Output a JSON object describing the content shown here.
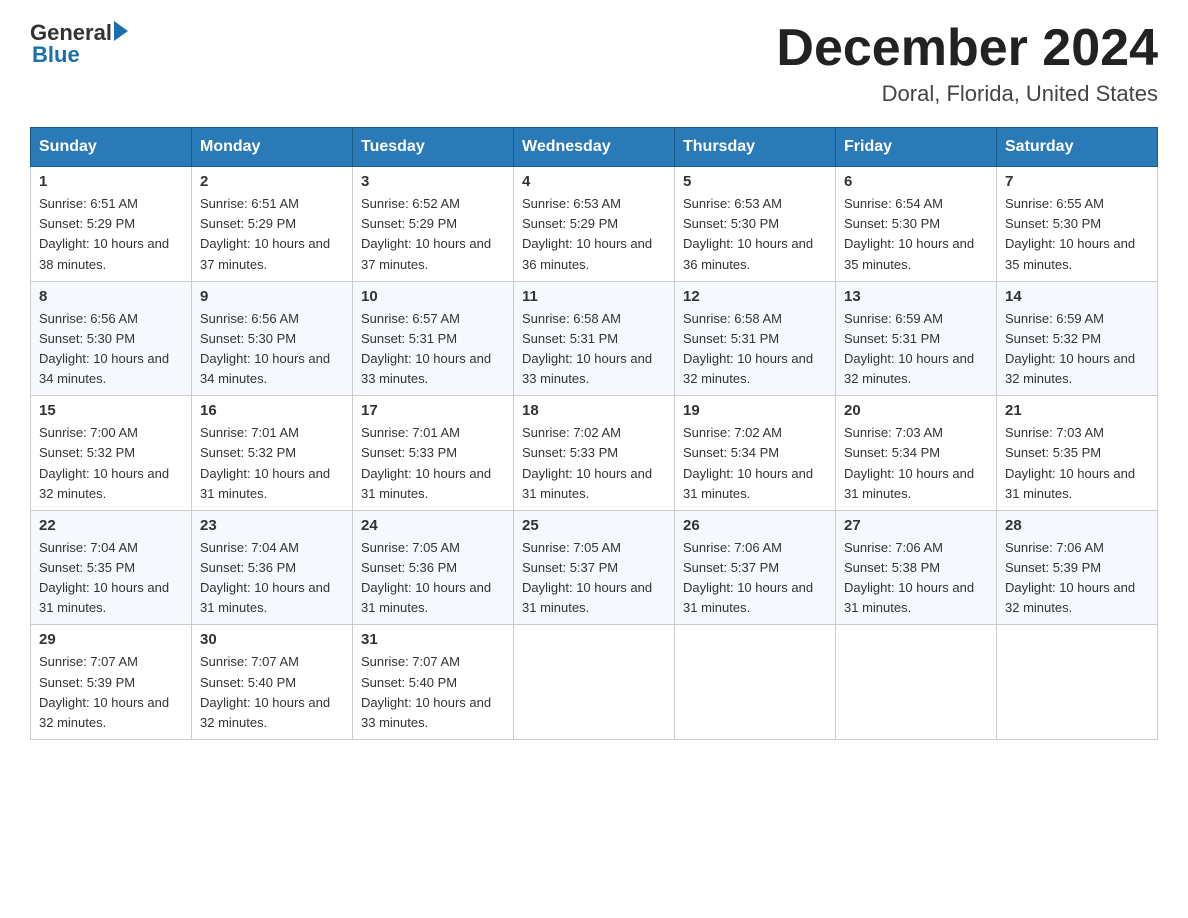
{
  "header": {
    "logo_general": "General",
    "logo_blue": "Blue",
    "month_title": "December 2024",
    "location": "Doral, Florida, United States"
  },
  "days_of_week": [
    "Sunday",
    "Monday",
    "Tuesday",
    "Wednesday",
    "Thursday",
    "Friday",
    "Saturday"
  ],
  "weeks": [
    [
      {
        "num": "1",
        "sunrise": "6:51 AM",
        "sunset": "5:29 PM",
        "daylight": "10 hours and 38 minutes."
      },
      {
        "num": "2",
        "sunrise": "6:51 AM",
        "sunset": "5:29 PM",
        "daylight": "10 hours and 37 minutes."
      },
      {
        "num": "3",
        "sunrise": "6:52 AM",
        "sunset": "5:29 PM",
        "daylight": "10 hours and 37 minutes."
      },
      {
        "num": "4",
        "sunrise": "6:53 AM",
        "sunset": "5:29 PM",
        "daylight": "10 hours and 36 minutes."
      },
      {
        "num": "5",
        "sunrise": "6:53 AM",
        "sunset": "5:30 PM",
        "daylight": "10 hours and 36 minutes."
      },
      {
        "num": "6",
        "sunrise": "6:54 AM",
        "sunset": "5:30 PM",
        "daylight": "10 hours and 35 minutes."
      },
      {
        "num": "7",
        "sunrise": "6:55 AM",
        "sunset": "5:30 PM",
        "daylight": "10 hours and 35 minutes."
      }
    ],
    [
      {
        "num": "8",
        "sunrise": "6:56 AM",
        "sunset": "5:30 PM",
        "daylight": "10 hours and 34 minutes."
      },
      {
        "num": "9",
        "sunrise": "6:56 AM",
        "sunset": "5:30 PM",
        "daylight": "10 hours and 34 minutes."
      },
      {
        "num": "10",
        "sunrise": "6:57 AM",
        "sunset": "5:31 PM",
        "daylight": "10 hours and 33 minutes."
      },
      {
        "num": "11",
        "sunrise": "6:58 AM",
        "sunset": "5:31 PM",
        "daylight": "10 hours and 33 minutes."
      },
      {
        "num": "12",
        "sunrise": "6:58 AM",
        "sunset": "5:31 PM",
        "daylight": "10 hours and 32 minutes."
      },
      {
        "num": "13",
        "sunrise": "6:59 AM",
        "sunset": "5:31 PM",
        "daylight": "10 hours and 32 minutes."
      },
      {
        "num": "14",
        "sunrise": "6:59 AM",
        "sunset": "5:32 PM",
        "daylight": "10 hours and 32 minutes."
      }
    ],
    [
      {
        "num": "15",
        "sunrise": "7:00 AM",
        "sunset": "5:32 PM",
        "daylight": "10 hours and 32 minutes."
      },
      {
        "num": "16",
        "sunrise": "7:01 AM",
        "sunset": "5:32 PM",
        "daylight": "10 hours and 31 minutes."
      },
      {
        "num": "17",
        "sunrise": "7:01 AM",
        "sunset": "5:33 PM",
        "daylight": "10 hours and 31 minutes."
      },
      {
        "num": "18",
        "sunrise": "7:02 AM",
        "sunset": "5:33 PM",
        "daylight": "10 hours and 31 minutes."
      },
      {
        "num": "19",
        "sunrise": "7:02 AM",
        "sunset": "5:34 PM",
        "daylight": "10 hours and 31 minutes."
      },
      {
        "num": "20",
        "sunrise": "7:03 AM",
        "sunset": "5:34 PM",
        "daylight": "10 hours and 31 minutes."
      },
      {
        "num": "21",
        "sunrise": "7:03 AM",
        "sunset": "5:35 PM",
        "daylight": "10 hours and 31 minutes."
      }
    ],
    [
      {
        "num": "22",
        "sunrise": "7:04 AM",
        "sunset": "5:35 PM",
        "daylight": "10 hours and 31 minutes."
      },
      {
        "num": "23",
        "sunrise": "7:04 AM",
        "sunset": "5:36 PM",
        "daylight": "10 hours and 31 minutes."
      },
      {
        "num": "24",
        "sunrise": "7:05 AM",
        "sunset": "5:36 PM",
        "daylight": "10 hours and 31 minutes."
      },
      {
        "num": "25",
        "sunrise": "7:05 AM",
        "sunset": "5:37 PM",
        "daylight": "10 hours and 31 minutes."
      },
      {
        "num": "26",
        "sunrise": "7:06 AM",
        "sunset": "5:37 PM",
        "daylight": "10 hours and 31 minutes."
      },
      {
        "num": "27",
        "sunrise": "7:06 AM",
        "sunset": "5:38 PM",
        "daylight": "10 hours and 31 minutes."
      },
      {
        "num": "28",
        "sunrise": "7:06 AM",
        "sunset": "5:39 PM",
        "daylight": "10 hours and 32 minutes."
      }
    ],
    [
      {
        "num": "29",
        "sunrise": "7:07 AM",
        "sunset": "5:39 PM",
        "daylight": "10 hours and 32 minutes."
      },
      {
        "num": "30",
        "sunrise": "7:07 AM",
        "sunset": "5:40 PM",
        "daylight": "10 hours and 32 minutes."
      },
      {
        "num": "31",
        "sunrise": "7:07 AM",
        "sunset": "5:40 PM",
        "daylight": "10 hours and 33 minutes."
      },
      null,
      null,
      null,
      null
    ]
  ],
  "labels": {
    "sunrise_prefix": "Sunrise: ",
    "sunset_prefix": "Sunset: ",
    "daylight_prefix": "Daylight: "
  }
}
